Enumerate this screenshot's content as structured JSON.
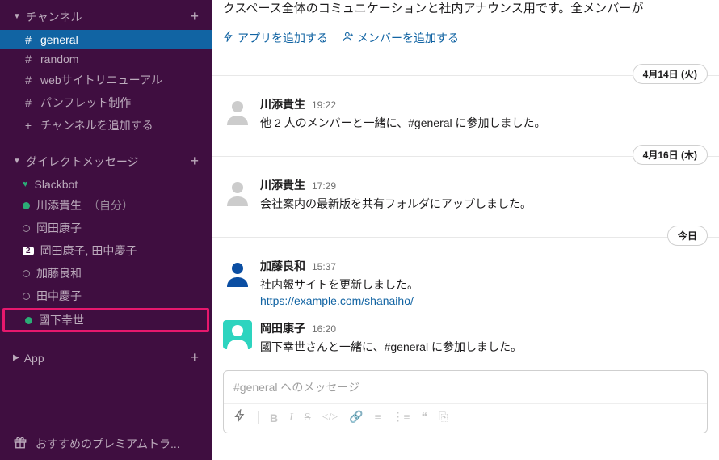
{
  "sidebar": {
    "channels_header": "チャンネル",
    "channels": [
      {
        "label": "general",
        "active": true
      },
      {
        "label": "random"
      },
      {
        "label": "webサイトリニューアル"
      },
      {
        "label": "パンフレット制作"
      }
    ],
    "add_channel": "チャンネルを追加する",
    "dm_header": "ダイレクトメッセージ",
    "dms": [
      {
        "label": "Slackbot",
        "type": "heart"
      },
      {
        "label": "川添貴生",
        "suffix": "（自分）",
        "type": "green"
      },
      {
        "label": "岡田康子",
        "type": "hollow"
      },
      {
        "label": "岡田康子, 田中慶子",
        "type": "badge",
        "badge": "2"
      },
      {
        "label": "加藤良和",
        "type": "hollow"
      },
      {
        "label": "田中慶子",
        "type": "hollow"
      },
      {
        "label": "國下幸世",
        "type": "green",
        "highlighted": true
      }
    ],
    "app_header": "App",
    "gift": "おすすめのプレミアムトラ..."
  },
  "main": {
    "intro": "クスペース全体のコミュニケーションと社内アナウンス用です。全メンバーが",
    "link_add_app": "アプリを追加する",
    "link_add_member": "メンバーを追加する",
    "dividers": [
      "4月14日 (火)",
      "4月16日 (木)",
      "今日"
    ],
    "messages": [
      {
        "name": "川添貴生",
        "time": "19:22",
        "avatar": "grey",
        "text": "他 2 人のメンバーと一緒に、#general に参加しました。"
      },
      {
        "name": "川添貴生",
        "time": "17:29",
        "avatar": "grey",
        "text": "会社案内の最新版を共有フォルダにアップしました。"
      },
      {
        "name": "加藤良和",
        "time": "15:37",
        "avatar": "blue",
        "text": "社内報サイトを更新しました。",
        "link": "https://example.com/shanaiho/"
      },
      {
        "name": "岡田康子",
        "time": "16:20",
        "avatar": "teal",
        "text": "國下幸世さんと一緒に、#general に参加しました。"
      }
    ],
    "composer_placeholder": "#general へのメッセージ"
  }
}
